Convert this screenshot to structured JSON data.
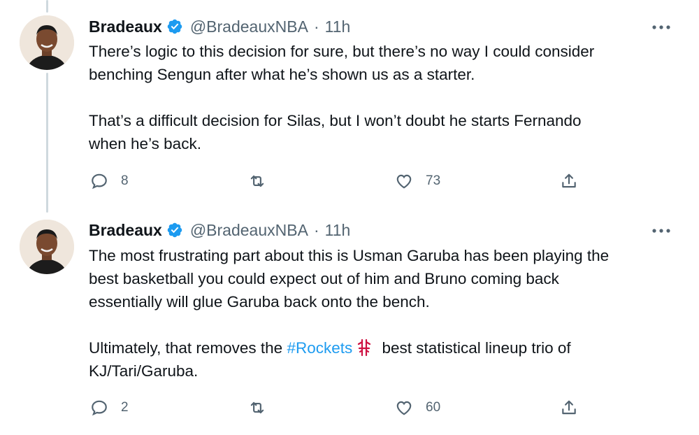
{
  "tweets": [
    {
      "name": "Bradeaux",
      "handle": "@BradeauxNBA",
      "separator": "·",
      "time": "11h",
      "lines_para1": [
        "There’s logic to this decision for sure, but there’s no way I could consider",
        "benching Sengun after what he’s shown us as a starter."
      ],
      "lines_para2": [
        "That’s a difficult decision for Silas, but I won’t doubt he starts Fernando",
        "when he’s back."
      ],
      "replies": "8",
      "retweets": "",
      "likes": "73"
    },
    {
      "name": "Bradeaux",
      "handle": "@BradeauxNBA",
      "separator": "·",
      "time": "11h",
      "lines_para1": [
        "The most frustrating part about this is Usman Garuba has been playing the",
        "best basketball you could expect out of him and Bruno coming back",
        "essentially will glue Garuba back onto the bench."
      ],
      "para2_prefix": "Ultimately, that removes the ",
      "hashtag": "#Rockets",
      "para2_suffix": " best statistical lineup trio of",
      "para2_line2": "KJ/Tari/Garuba.",
      "replies": "2",
      "retweets": "",
      "likes": "60"
    }
  ],
  "icons": {
    "reply": "reply-icon",
    "retweet": "retweet-icon",
    "like": "heart-icon",
    "share": "share-icon",
    "more": "more-options-icon",
    "verified": "verified-badge-icon",
    "rockets": "rockets-logo-icon"
  },
  "colors": {
    "text": "#0f1419",
    "secondary": "#536471",
    "link": "#1d9bf0",
    "verified": "#1d9bf0",
    "thread_line": "#cfd9de",
    "rockets_red": "#ce1141"
  }
}
